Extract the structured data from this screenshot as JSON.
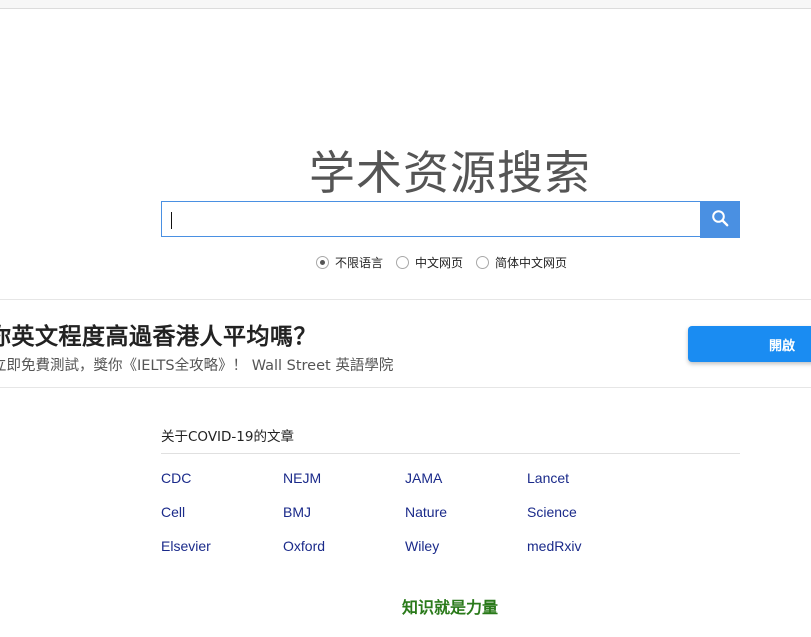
{
  "header": {
    "title": "学术资源搜索"
  },
  "search": {
    "value": "",
    "placeholder": ""
  },
  "language_options": [
    {
      "label": "不限语言",
      "selected": true
    },
    {
      "label": "中文网页",
      "selected": false
    },
    {
      "label": "简体中文网页",
      "selected": false
    }
  ],
  "ad": {
    "headline": "你英文程度高過香港人平均嗎？",
    "subtext": "立即免費測試，獎你《IELTS全攻略》！ Wall Street 英語學院",
    "button_label": "開啟"
  },
  "covid": {
    "title": "关于COVID-19的文章",
    "links": [
      "CDC",
      "NEJM",
      "JAMA",
      "Lancet",
      "Cell",
      "BMJ",
      "Nature",
      "Science",
      "Elsevier",
      "Oxford",
      "Wiley",
      "medRxiv"
    ]
  },
  "footer": {
    "motto": "知识就是力量"
  },
  "colors": {
    "accent": "#4a90e2",
    "ad_button": "#1a8cf2",
    "link": "#1a2a8a",
    "motto": "#2a7a1a"
  },
  "icons": {
    "search_button": "search-icon"
  }
}
